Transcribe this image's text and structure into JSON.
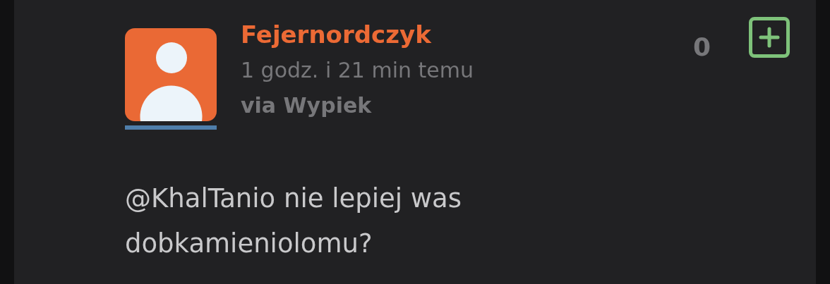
{
  "comment": {
    "author": "Fejernordczyk",
    "time": "1 godz. i 21 min temu",
    "via": "via Wypiek",
    "votes": "0",
    "text": "@KhalTanio nie lepiej was dobkamieniolomu?"
  }
}
